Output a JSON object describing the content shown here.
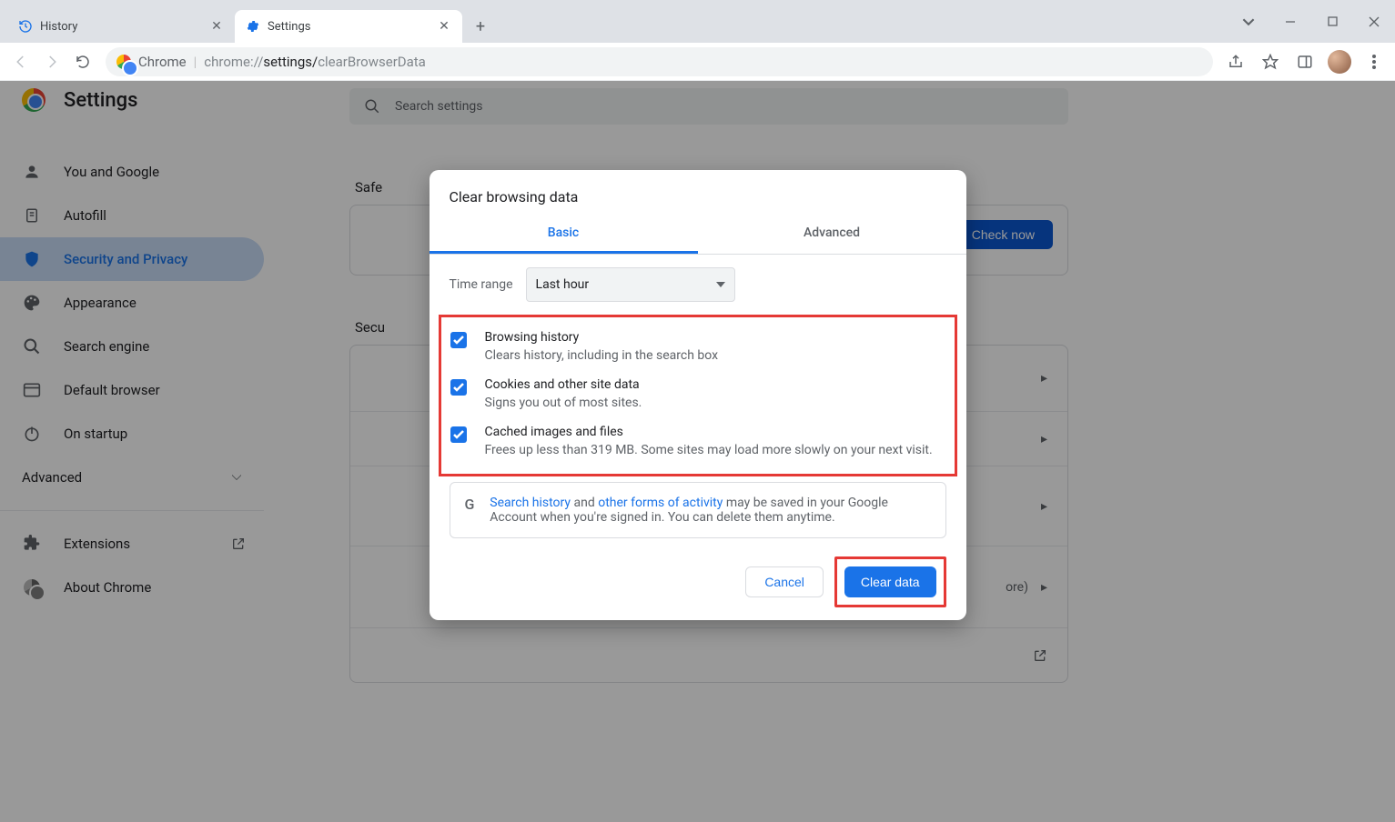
{
  "tabs": {
    "history_label": "History",
    "settings_label": "Settings"
  },
  "omnibox": {
    "scheme_label": "Chrome",
    "url_pre": "chrome://",
    "url_main": "settings/",
    "url_tail": "clearBrowserData"
  },
  "settings": {
    "title": "Settings",
    "search_placeholder": "Search settings"
  },
  "sidebar": {
    "you_google": "You and Google",
    "autofill": "Autofill",
    "security": "Security and Privacy",
    "appearance": "Appearance",
    "search_engine": "Search engine",
    "default_browser": "Default browser",
    "on_startup": "On startup",
    "advanced": "Advanced",
    "extensions": "Extensions",
    "about": "About Chrome"
  },
  "main": {
    "safety_label_partial": "Safe",
    "security_label_partial": "Secu",
    "more_partial": "ore)",
    "check_now": "Check now"
  },
  "dialog": {
    "title": "Clear browsing data",
    "tab_basic": "Basic",
    "tab_advanced": "Advanced",
    "time_range_label": "Time range",
    "time_range_value": "Last hour",
    "items": [
      {
        "title": "Browsing history",
        "desc": "Clears history, including in the search box"
      },
      {
        "title": "Cookies and other site data",
        "desc": "Signs you out of most sites."
      },
      {
        "title": "Cached images and files",
        "desc": "Frees up less than 319 MB. Some sites may load more slowly on your next visit."
      }
    ],
    "info_link1": "Search history",
    "info_text1": " and ",
    "info_link2": "other forms of activity",
    "info_text2": " may be saved in your Google Account when you're signed in. You can delete them anytime.",
    "cancel": "Cancel",
    "clear": "Clear data"
  }
}
